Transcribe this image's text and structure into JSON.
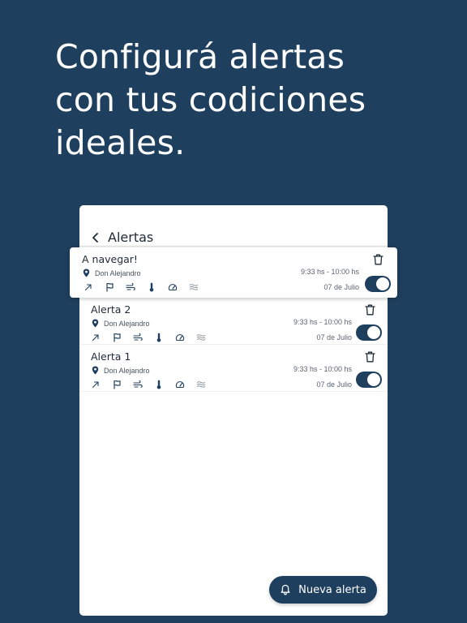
{
  "headline": {
    "line1": "Configurá alertas",
    "line2": "con tus codiciones",
    "line3": "ideales."
  },
  "header": {
    "title": "Alertas",
    "back_icon": "chevron-left-icon"
  },
  "alerts": [
    {
      "name": "A navegar!",
      "location": "Don Alejandro",
      "time": "9:33 hs - 10:00 hs",
      "date": "07 de Julio",
      "enabled": true
    },
    {
      "name": "Alerta 2",
      "location": "Don Alejandro",
      "time": "9:33 hs - 10:00 hs",
      "date": "07 de Julio",
      "enabled": true
    },
    {
      "name": "Alerta 1",
      "location": "Don Alejandro",
      "time": "9:33 hs - 10:00 hs",
      "date": "07 de Julio",
      "enabled": true
    }
  ],
  "condition_icons": [
    "arrow-up-right-icon",
    "flag-icon",
    "wind-icon",
    "thermometer-icon",
    "gauge-icon",
    "waves-icon"
  ],
  "fab": {
    "label": "Nueva alerta",
    "icon": "bell-icon"
  },
  "colors": {
    "primary": "#1f3f5e",
    "surface": "#ffffff",
    "text": "#1f2a36"
  }
}
